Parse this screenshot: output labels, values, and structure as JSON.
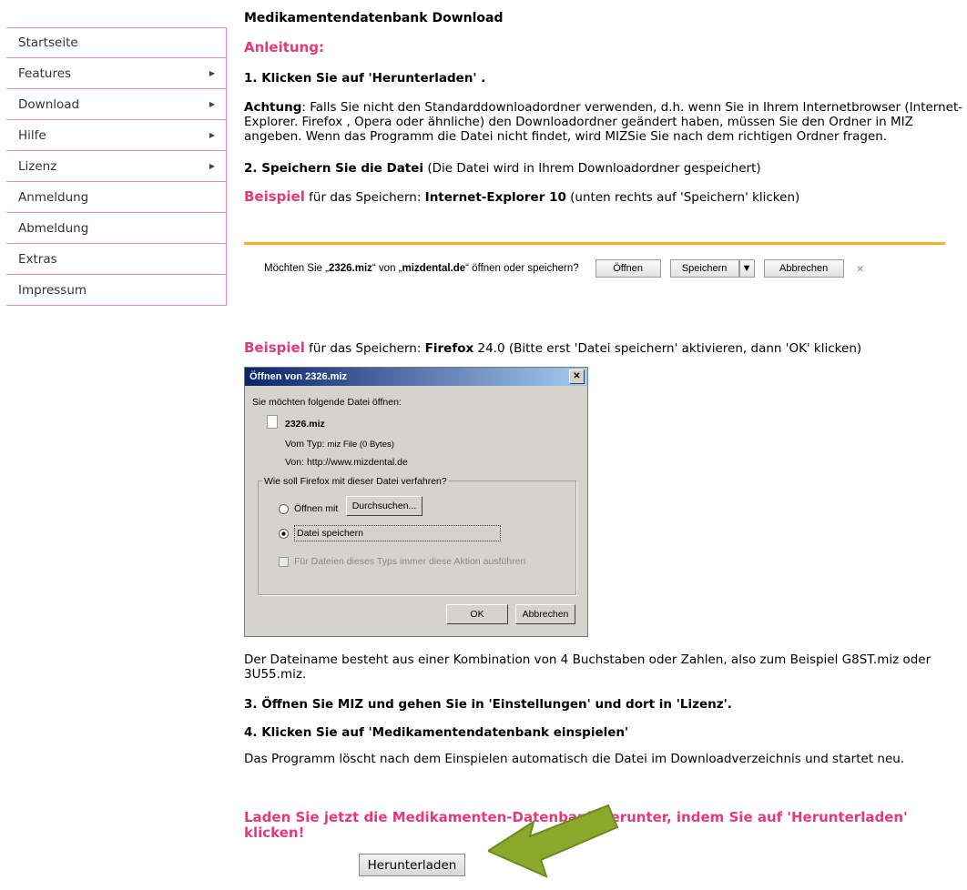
{
  "sidebar": {
    "items": [
      {
        "label": "Startseite",
        "arrow": false
      },
      {
        "label": "Features",
        "arrow": true
      },
      {
        "label": "Download",
        "arrow": true
      },
      {
        "label": "Hilfe",
        "arrow": true
      },
      {
        "label": "Lizenz",
        "arrow": true
      },
      {
        "label": "Anmeldung",
        "arrow": false
      },
      {
        "label": "Abmeldung",
        "arrow": false
      },
      {
        "label": "Extras",
        "arrow": false
      },
      {
        "label": "Impressum",
        "arrow": false
      }
    ]
  },
  "main": {
    "title": "Medikamentendatenbank Download",
    "anleitung": "Anleitung:",
    "step1": "1. Klicken Sie auf 'Herunterladen' .",
    "achtung_label": "Achtung",
    "achtung_text": ": Falls Sie nicht den Standarddownloadordner verwenden, d.h. wenn Sie in Ihrem Internetbrowser (Internet-Explorer. Firefox , Opera oder ähnliche) den Downloadordner geändert haben, müssen Sie den Ordner in MIZ angeben. Wenn das Programm die Datei nicht findet, wird MIZSie Sie nach dem richtigen Ordner fragen.",
    "step2_bold": "2. Speichern Sie die Datei",
    "step2_rest": " (Die Datei wird in Ihrem Downloadordner gespeichert)",
    "beispiel": "Beispiel",
    "ex1_mid": " für das Speichern: ",
    "ex1_browser": "Internet-Explorer 10",
    "ex1_rest": " (unten rechts auf 'Speichern' klicken)",
    "ex2_mid": " für das Speichern: ",
    "ex2_browser": "Firefox",
    "ex2_rest": " 24.0 (Bitte erst 'Datei speichern' aktivieren, dann 'OK' klicken)",
    "dateiname_text": "Der Dateiname besteht aus einer Kombination von 4 Buchstaben oder Zahlen, also zum Beispiel G8ST.miz oder 3U55.miz.",
    "step3": "3. Öffnen Sie MIZ und gehen Sie in 'Einstellungen' und dort in 'Lizenz'.",
    "step4": "4. Klicken Sie auf 'Medikamentendatenbank einspielen'",
    "loescht_text": "Das Programm löscht nach dem Einspielen automatisch die Datei im Downloadverzeichnis und startet neu.",
    "cta": "Laden Sie jetzt die Medikamenten-Datenbank herunter, indem Sie auf 'Herunterladen' klicken!",
    "download_button": "Herunterladen"
  },
  "ie_bar": {
    "prompt_pre": "Möchten Sie „",
    "filename": "2326.miz",
    "prompt_mid": "“ von „",
    "domain": "mizdental.de",
    "prompt_post": "“ öffnen oder speichern?",
    "open": "Öffnen",
    "save": "Speichern",
    "cancel": "Abbrechen",
    "close": "×"
  },
  "firefox_dialog": {
    "title": "Öffnen von 2326.miz",
    "intro": "Sie möchten folgende Datei öffnen:",
    "filename": "2326.miz",
    "type_label": "Vom Typ:",
    "type_value": "miz File (0 Bytes)",
    "from_label": "Von:",
    "from_value": "http://www.mizdental.de",
    "group_label": "Wie soll Firefox mit dieser Datei verfahren?",
    "open_with": "Öffnen mit",
    "browse": "Durchsuchen...",
    "save_file": "Datei speichern",
    "always": "Für Dateien dieses Typs immer diese Aktion ausführen",
    "ok": "OK",
    "cancel": "Abbrechen"
  },
  "colors": {
    "accent": "#e5397a",
    "nav_border": "#e08ad2",
    "arrow_green": "#8aa82c"
  }
}
